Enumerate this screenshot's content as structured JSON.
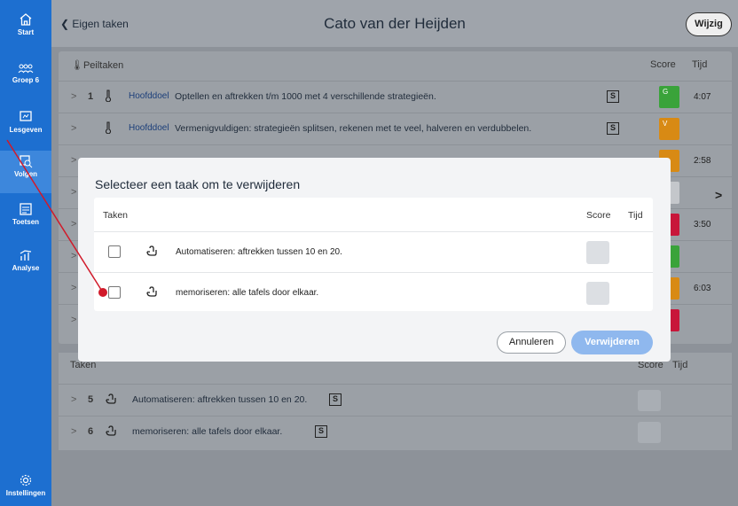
{
  "sidebar": {
    "items": [
      {
        "label": "Start",
        "icon": "home-icon"
      },
      {
        "label": "Groep 6",
        "icon": "group-icon"
      },
      {
        "label": "Lesgeven",
        "icon": "presentation-icon"
      },
      {
        "label": "Volgen",
        "icon": "track-icon"
      },
      {
        "label": "Toetsen",
        "icon": "test-icon"
      },
      {
        "label": "Analyse",
        "icon": "chart-icon"
      },
      {
        "label": "Instellingen",
        "icon": "gear-icon"
      }
    ]
  },
  "header": {
    "back_label": "Eigen taken",
    "title": "Cato van der Heijden",
    "edit_label": "Wijzig"
  },
  "peiltaken": {
    "heading": "Peiltaken",
    "score_header": "Score",
    "time_header": "Tijd",
    "rows": [
      {
        "num": "1",
        "tag": "Hoofddoel",
        "text": "Optellen en aftrekken t/m 1000 met 4 verschillende strategieën.",
        "badge": "S",
        "score": "G",
        "score_color": "#3aa33a",
        "time": "4:07"
      },
      {
        "num": "",
        "tag": "Hoofddoel",
        "text": "Vermenigvuldigen: strategieën splitsen, rekenen met te veel, halveren en verdubbelen.",
        "badge": "S",
        "score": "V",
        "score_color": "#d88a14",
        "time": ""
      },
      {
        "num": "",
        "tag": "",
        "text": "",
        "badge": "",
        "score": "",
        "score_color": "#d88a14",
        "time": "2:58"
      },
      {
        "num": "",
        "tag": "",
        "text": "",
        "badge": "",
        "score": "",
        "score_color": "#c4c7cb",
        "time": ""
      },
      {
        "num": "",
        "tag": "",
        "text": "",
        "badge": "",
        "score": "",
        "score_color": "#c8163a",
        "time": "3:50"
      },
      {
        "num": "",
        "tag": "",
        "text": "",
        "badge": "",
        "score": "",
        "score_color": "#3aa33a",
        "time": ""
      },
      {
        "num": "",
        "tag": "",
        "text": "",
        "badge": "",
        "score": "",
        "score_color": "#d88a14",
        "time": "6:03"
      },
      {
        "num": "",
        "tag": "",
        "text": "",
        "badge": "",
        "score": "",
        "score_color": "#c8163a",
        "time": ""
      }
    ]
  },
  "taken": {
    "heading": "Taken",
    "score_header": "Score",
    "time_header": "Tijd",
    "rows": [
      {
        "num": "5",
        "text": "Automatiseren: aftrekken tussen 10 en 20.",
        "badge": "S"
      },
      {
        "num": "6",
        "text": "memoriseren: alle tafels door elkaar.",
        "badge": "S"
      }
    ]
  },
  "modal": {
    "title": "Selecteer een taak om te verwijderen",
    "col_tasks": "Taken",
    "col_score": "Score",
    "col_time": "Tijd",
    "rows": [
      {
        "label": "Automatiseren: aftrekken tussen 10 en 20."
      },
      {
        "label": "memoriseren: alle tafels door elkaar."
      }
    ],
    "cancel_label": "Annuleren",
    "delete_label": "Verwijderen"
  },
  "colors": {
    "sidebar": "#1d6fd0",
    "annotation": "#d11a2a",
    "primary_button": "#8fb8ee"
  }
}
